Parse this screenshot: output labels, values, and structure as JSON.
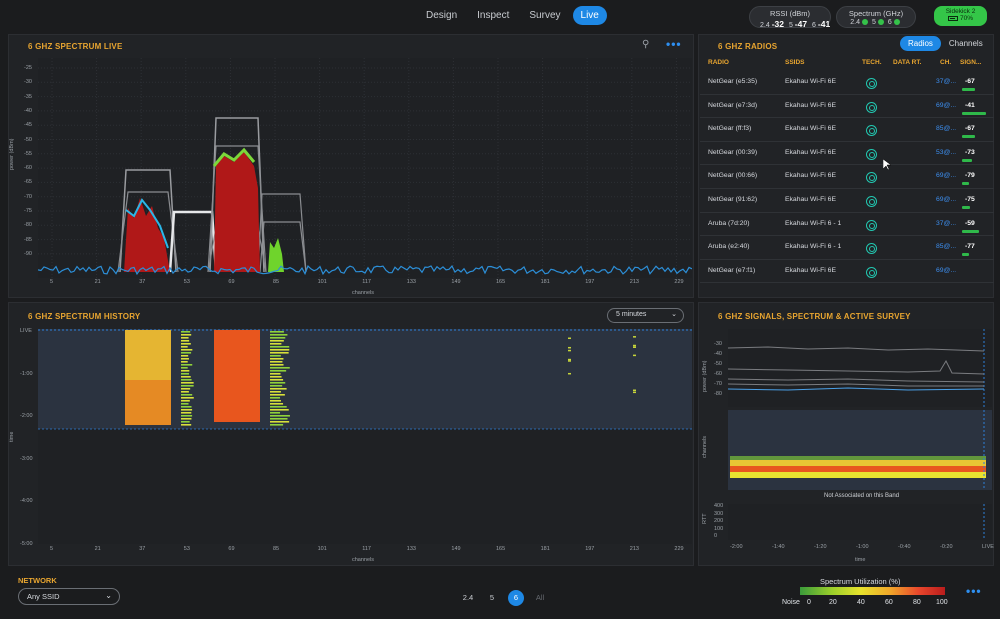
{
  "nav": {
    "tabs": [
      "Design",
      "Inspect",
      "Survey",
      "Live"
    ],
    "active": 3
  },
  "rssi": {
    "title": "RSSI (dBm)",
    "b1": "2.4",
    "v1": "-32",
    "b2": "5",
    "v2": "-47",
    "b3": "6",
    "v3": "-41"
  },
  "spectrum_ghz": {
    "title": "Spectrum (GHz)",
    "b1": "2.4",
    "b2": "5",
    "b3": "6"
  },
  "sidekick": {
    "name": "Sidekick 2",
    "battery": "70%"
  },
  "live_panel": {
    "title": "6 GHZ SPECTRUM LIVE",
    "ylabel": "power (dBm)",
    "xlabel": "channels",
    "yticks": [
      "-25",
      "-30",
      "-35",
      "-40",
      "-45",
      "-50",
      "-55",
      "-60",
      "-65",
      "-70",
      "-75",
      "-80",
      "-85",
      "-90"
    ],
    "xticks": [
      "5",
      "21",
      "37",
      "53",
      "69",
      "85",
      "101",
      "117",
      "133",
      "149",
      "165",
      "181",
      "197",
      "213",
      "229"
    ]
  },
  "radios_panel": {
    "title": "6 GHZ RADIOS",
    "toggle": [
      "Radios",
      "Channels"
    ],
    "columns": [
      "RADIO",
      "SSIDS",
      "TECH.",
      "DATA RT.",
      "CH.",
      "SIGN..."
    ],
    "rows": [
      {
        "radio": "NetGear (e5:35)",
        "ssid": "Ekahau Wi-Fi 6E",
        "ch": "37@...",
        "signal": "-67",
        "level": 0.55
      },
      {
        "radio": "NetGear (e7:3d)",
        "ssid": "Ekahau Wi-Fi 6E",
        "ch": "69@...",
        "signal": "-41",
        "level": 1.0
      },
      {
        "radio": "NetGear (ff:f3)",
        "ssid": "Ekahau Wi-Fi 6E",
        "ch": "85@...",
        "signal": "-67",
        "level": 0.55
      },
      {
        "radio": "NetGear (00:39)",
        "ssid": "Ekahau Wi-Fi 6E",
        "ch": "53@...",
        "signal": "-73",
        "level": 0.4
      },
      {
        "radio": "NetGear (00:66)",
        "ssid": "Ekahau Wi-Fi 6E",
        "ch": "69@...",
        "signal": "-79",
        "level": 0.3
      },
      {
        "radio": "NetGear (91:62)",
        "ssid": "Ekahau Wi-Fi 6E",
        "ch": "69@...",
        "signal": "-75",
        "level": 0.35
      },
      {
        "radio": "Aruba (7d:20)",
        "ssid": "Ekahau Wi-Fi 6 - 1",
        "ch": "37@...",
        "signal": "-59",
        "level": 0.7
      },
      {
        "radio": "Aruba (e2:40)",
        "ssid": "Ekahau Wi-Fi 6 - 1",
        "ch": "85@...",
        "signal": "-77",
        "level": 0.3
      },
      {
        "radio": "NetGear (e7:f1)",
        "ssid": "Ekahau Wi-Fi 6E",
        "ch": "69@...",
        "signal": "",
        "level": 0
      }
    ]
  },
  "history_panel": {
    "title": "6 GHZ SPECTRUM HISTORY",
    "dropdown": "5 minutes",
    "ylabel": "time",
    "xlabel": "channels",
    "yticks": [
      "LIVE",
      "-1:00",
      "-2:00",
      "-3:00",
      "-4:00",
      "-5:00"
    ],
    "xticks": [
      "5",
      "21",
      "37",
      "53",
      "69",
      "85",
      "101",
      "117",
      "133",
      "149",
      "165",
      "181",
      "197",
      "213",
      "229"
    ]
  },
  "signals_panel": {
    "title": "6 GHZ SIGNALS, SPECTRUM & ACTIVE SURVEY",
    "power_label": "power (dBm)",
    "power_ticks": [
      "-30",
      "-40",
      "-50",
      "-60",
      "-70",
      "-80"
    ],
    "channels_label": "channels",
    "note": "Not Associated on this Band",
    "rtt_label": "RTT",
    "rtt_ticks": [
      "400",
      "300",
      "200",
      "100",
      "0"
    ],
    "time_label": "time",
    "time_ticks": [
      "-2:00",
      "-1:40",
      "-1:20",
      "-1:00",
      "-0:40",
      "-0:20",
      "LIVE"
    ]
  },
  "network": {
    "label": "NETWORK",
    "value": "Any SSID"
  },
  "bands": {
    "items": [
      "2.4",
      "5",
      "6",
      "All"
    ],
    "active": 2
  },
  "utilization": {
    "title": "Spectrum Utilization (%)",
    "ticks": [
      "Noise",
      "0",
      "20",
      "40",
      "60",
      "80",
      "100"
    ]
  }
}
